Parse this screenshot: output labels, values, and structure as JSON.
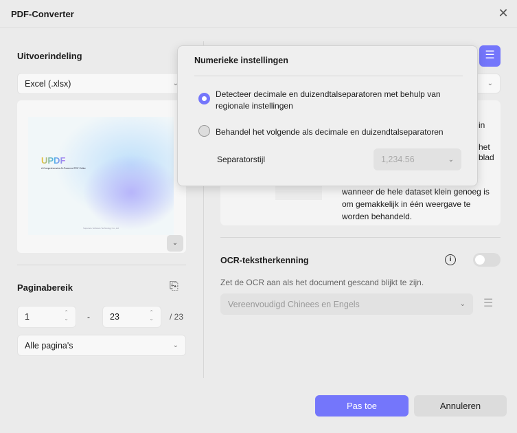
{
  "window": {
    "title": "PDF-Converter"
  },
  "left": {
    "output_format_heading": "Uitvoerindeling",
    "format_value": "Excel (.xlsx)",
    "preview": {
      "logo": "UPDF",
      "subtitle": "A Comprehensive AI-Powered PDF Editor",
      "footer": "Superace Software Technology Co.,Ltd"
    },
    "page_range_heading": "Paginabereik",
    "from_page": "1",
    "dash": "-",
    "to_page": "23",
    "total": "/ 23",
    "pages_option": "Alle pagina's"
  },
  "right": {
    "card_fragments": [
      "in",
      "het",
      "blad"
    ],
    "card_text": [
      "wanneer de hele dataset klein genoeg is",
      "om gemakkelijk in één weergave te",
      "worden behandeld."
    ],
    "ocr_heading": "OCR-tekstherkenning",
    "ocr_hint": "Zet de OCR aan als het document gescand blijkt te zijn.",
    "ocr_language": "Vereenvoudigd Chinees en Engels",
    "ocr_enabled": false
  },
  "popup": {
    "title": "Numerieke instellingen",
    "option1_line1": "Detecteer decimale en duizendtalseparatoren met behulp van",
    "option1_line2": "regionale instellingen",
    "option2": "Behandel het volgende als decimale en duizendtalseparatoren",
    "separator_label": "Separatorstijl",
    "separator_value": "1,234.56",
    "selected_option": 1
  },
  "footer": {
    "apply": "Pas toe",
    "cancel": "Annuleren"
  },
  "colors": {
    "accent": "#7476fb"
  }
}
